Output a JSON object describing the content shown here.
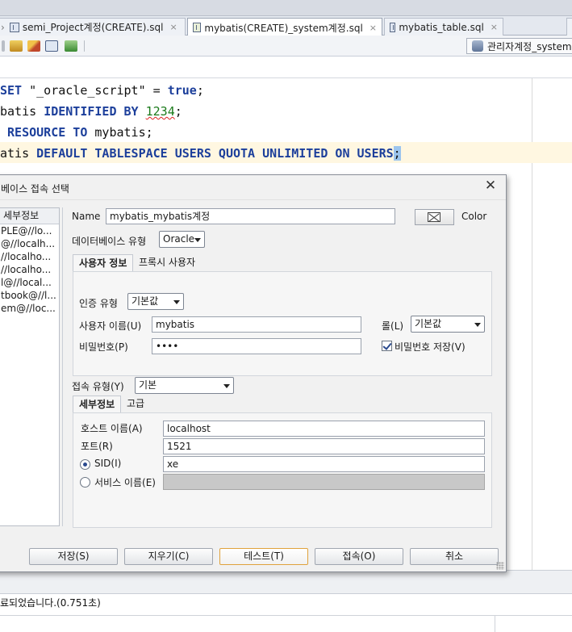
{
  "editor_tabs": [
    {
      "label": "semi_Project계정(CREATE).sql",
      "active": false
    },
    {
      "label": "mybatis(CREATE)_system계정.sql",
      "active": true
    },
    {
      "label": "mybatis_table.sql",
      "active": false
    }
  ],
  "connection_selector": {
    "label": "관리자계정_system"
  },
  "code": {
    "line1": {
      "kw1": "SET",
      "str": " \"_oracle_script\" = ",
      "kw2": "true",
      "end": ";"
    },
    "line2": {
      "pre": "batis ",
      "kw": "IDENTIFIED BY",
      "num": "1234",
      "end": ";"
    },
    "line3": {
      "kw1": " RESOURCE TO",
      "rest": " mybatis;"
    },
    "line4": {
      "pre": "atis ",
      "kw": "DEFAULT TABLESPACE USERS QUOTA UNLIMITED ON USERS",
      "end": ";"
    }
  },
  "dialog": {
    "title": "베이스 접속 선택",
    "list_header": "세부정보",
    "list_items": [
      "PLE@//lo...",
      "@//localh...",
      "//localho...",
      "//localho...",
      "l@//local...",
      "tbook@//l...",
      "em@//loc..."
    ],
    "name_label": "Name",
    "name_value": "mybatis_mybatis계정",
    "color_label": "Color",
    "db_type_label": "데이터베이스 유형",
    "db_type_value": "Oracle",
    "tabs": {
      "user_info": "사용자 정보",
      "proxy_user": "프록시 사용자"
    },
    "auth_type_label": "인증 유형",
    "auth_type_value": "기본값",
    "username_label": "사용자 이름(U)",
    "username_value": "mybatis",
    "role_label": "롤(L)",
    "role_value": "기본값",
    "password_label": "비밀번호(P)",
    "password_value": "••••",
    "save_password_label": "비밀번호 저장(V)",
    "conn_type_label": "접속 유형(Y)",
    "conn_type_value": "기본",
    "subtabs": {
      "details": "세부정보",
      "advanced": "고급"
    },
    "hostname_label": "호스트 이름(A)",
    "hostname_value": "localhost",
    "port_label": "포트(R)",
    "port_value": "1521",
    "sid_label": "SID(I)",
    "sid_value": "xe",
    "service_label": "서비스 이름(E)",
    "service_value": "",
    "buttons": {
      "save": "저장(S)",
      "clear": "지우기(C)",
      "test": "테스트(T)",
      "connect": "접속(O)",
      "cancel": "취소"
    }
  },
  "status": {
    "message": "료되었습니다.(0.751초)"
  }
}
